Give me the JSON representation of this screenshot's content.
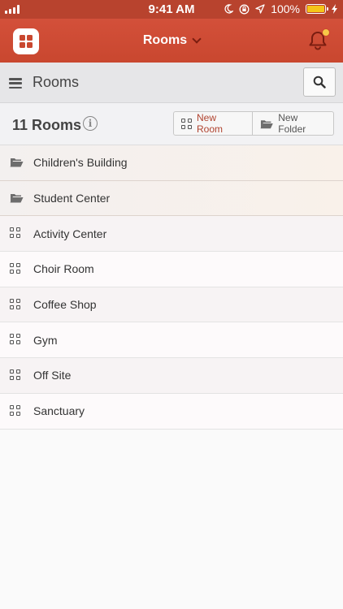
{
  "status_bar": {
    "time": "9:41 AM",
    "battery": "100%",
    "battery_level": 1.0
  },
  "header": {
    "title": "Rooms",
    "logo_icon": "app-grid-icon",
    "notification_icon": "bell-icon",
    "notification_dot_color": "#f7c948",
    "accent_color": "#c9472f"
  },
  "subheader": {
    "title": "Rooms",
    "menu_icon": "hamburger-icon",
    "search_icon": "search-icon"
  },
  "toolbar": {
    "count_label": "11 Rooms",
    "new_room_label": "New Room",
    "new_folder_label": "New Folder"
  },
  "folders": [
    {
      "label": "Children's Building"
    },
    {
      "label": "Student Center"
    }
  ],
  "rooms": [
    {
      "label": "Activity Center"
    },
    {
      "label": "Choir Room"
    },
    {
      "label": "Coffee Shop"
    },
    {
      "label": "Gym"
    },
    {
      "label": "Off Site"
    },
    {
      "label": "Sanctuary"
    }
  ]
}
